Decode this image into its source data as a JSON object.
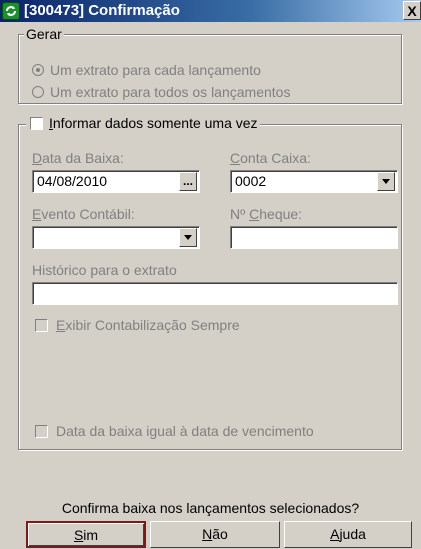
{
  "window": {
    "title": "[300473] Confirmação",
    "close_label": "X"
  },
  "gerar": {
    "legend": "Gerar",
    "options": [
      {
        "label": "Um extrato para cada lançamento",
        "checked": true
      },
      {
        "label": "Um extrato para todos os lançamentos",
        "checked": false
      }
    ]
  },
  "informar": {
    "checkbox_label_prefix": "I",
    "checkbox_label_rest": "nformar dados somente uma vez",
    "checked": false
  },
  "fields": {
    "data_baixa": {
      "label_u": "D",
      "label_rest": "ata da Baixa:",
      "value": "04/08/2010",
      "button": "..."
    },
    "conta_caixa": {
      "label_u": "C",
      "label_rest": "onta Caixa:",
      "value": "0002"
    },
    "evento_contabil": {
      "label_u": "E",
      "label_rest": "vento Contábil:",
      "value": ""
    },
    "n_cheque": {
      "label_pre": "Nº ",
      "label_u": "C",
      "label_rest": "heque:",
      "value": ""
    },
    "historico": {
      "label": "Histórico para o extrato",
      "value": ""
    }
  },
  "checks": {
    "exibir_u": "E",
    "exibir_rest": "xibir Contabilização Sempre",
    "data_vencimento": "Data da baixa igual à data de vencimento"
  },
  "footer": {
    "message": "Confirma baixa nos lançamentos selecionados?",
    "sim_u": "S",
    "sim_rest": "im",
    "nao_u": "N",
    "nao_rest": "ão",
    "ajuda_u": "A",
    "ajuda_rest": "juda"
  }
}
